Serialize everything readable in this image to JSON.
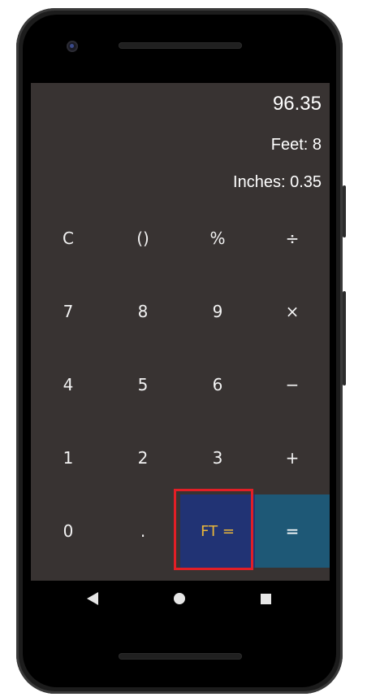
{
  "display": {
    "result": "96.35",
    "feet": "Feet: 8",
    "inches": "Inches: 0.35"
  },
  "keys": {
    "clear": "C",
    "parens": "()",
    "percent": "%",
    "divide": "÷",
    "seven": "7",
    "eight": "8",
    "nine": "9",
    "multiply": "×",
    "four": "4",
    "five": "5",
    "six": "6",
    "minus": "−",
    "one": "1",
    "two": "2",
    "three": "3",
    "plus": "+",
    "zero": "0",
    "dot": ".",
    "ft_equals": "FT =",
    "equals": "="
  },
  "colors": {
    "screen_bg": "#383332",
    "ft_key_bg": "#213374",
    "ft_key_text": "#e9b63a",
    "equals_key_bg": "#1e5876",
    "highlight": "#e21f26"
  },
  "icons": {
    "nav_back": "back-triangle-icon",
    "nav_home": "home-circle-icon",
    "nav_recents": "recents-square-icon"
  }
}
